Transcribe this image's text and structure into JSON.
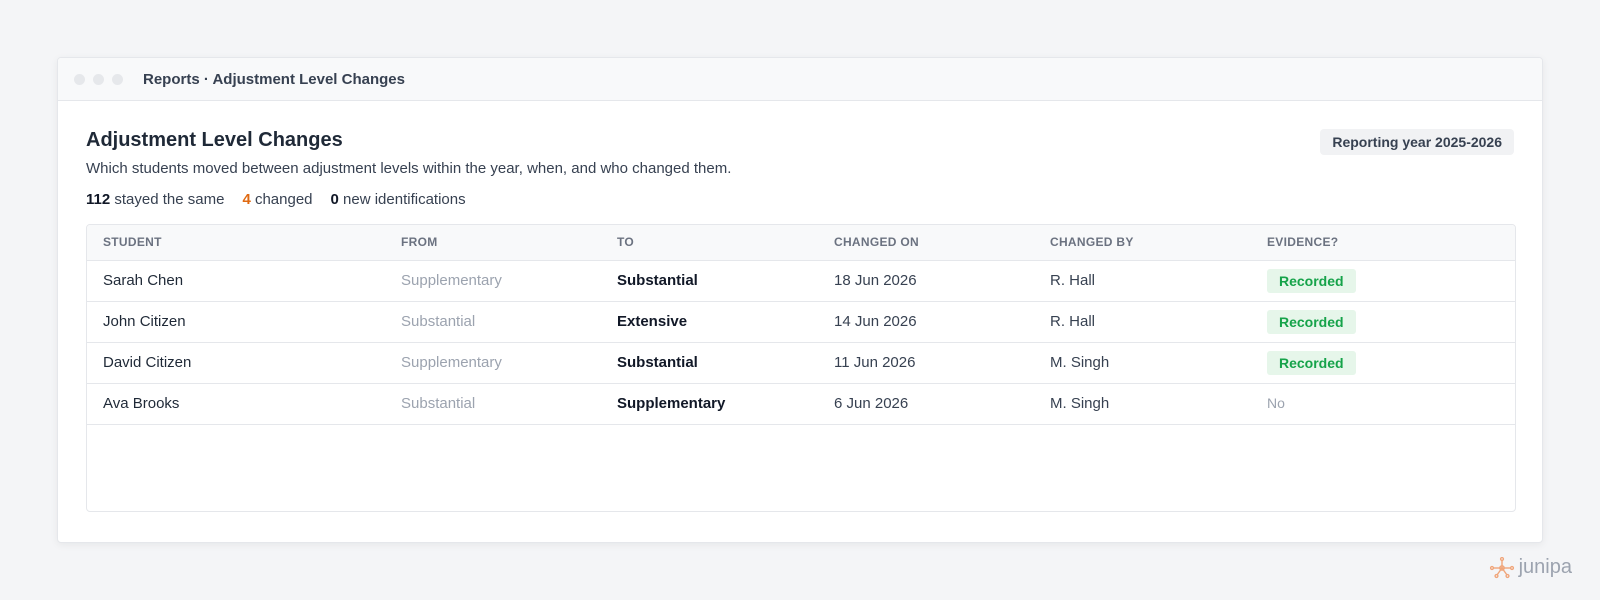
{
  "window": {
    "title": "Reports · Adjustment Level Changes"
  },
  "page": {
    "title": "Adjustment Level Changes",
    "subtitle": "Which students moved between adjustment levels within the year, when, and who changed them.",
    "year_badge": "Reporting year 2025-2026"
  },
  "stats": {
    "same_count": "112",
    "same_label": "stayed the same",
    "changed_count": "4",
    "changed_label": "changed",
    "new_count": "0",
    "new_label": "new identifications"
  },
  "table": {
    "headers": [
      "STUDENT",
      "FROM",
      "TO",
      "CHANGED ON",
      "CHANGED BY",
      "EVIDENCE?"
    ],
    "rows": [
      {
        "student": "Sarah Chen",
        "from": "Supplementary",
        "to": "Substantial",
        "changed_on": "18 Jun 2026",
        "changed_by": "R. Hall",
        "evidence": "Recorded"
      },
      {
        "student": "John Citizen",
        "from": "Substantial",
        "to": "Extensive",
        "changed_on": "14 Jun 2026",
        "changed_by": "R. Hall",
        "evidence": "Recorded"
      },
      {
        "student": "David Citizen",
        "from": "Supplementary",
        "to": "Substantial",
        "changed_on": "11 Jun 2026",
        "changed_by": "M. Singh",
        "evidence": "Recorded"
      },
      {
        "student": "Ava Brooks",
        "from": "Substantial",
        "to": "Supplementary",
        "changed_on": "6 Jun 2026",
        "changed_by": "M. Singh",
        "evidence": "No"
      }
    ]
  },
  "brand": {
    "name": "junipa",
    "icon": "network-node-icon",
    "color": "#f0a57a"
  },
  "colors": {
    "accent_changed": "#e06a12",
    "recorded_green": "#16a34a",
    "recorded_bg": "#e6f6ea"
  }
}
